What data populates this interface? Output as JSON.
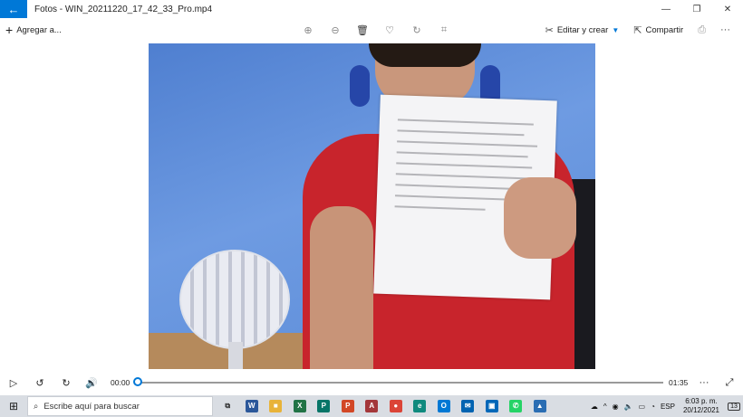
{
  "window": {
    "back_icon": "back-arrow-icon",
    "title": "Fotos - WIN_20211220_17_42_33_Pro.mp4",
    "controls": [
      "minimize-icon",
      "maximize-icon",
      "close-icon"
    ]
  },
  "toolbar": {
    "add_label": "Agregar a...",
    "center_icons": [
      "zoom-in-icon",
      "zoom-out-icon",
      "delete-icon",
      "heart-icon",
      "rotate-icon",
      "crop-icon"
    ],
    "edit_label": "Editar y crear",
    "share_label": "Compartir",
    "more_icon": "more-icon"
  },
  "player": {
    "current_time": "00:00",
    "duration": "01:35",
    "progress": 0,
    "icons": [
      "play-icon",
      "rewind-10-icon",
      "forward-30-icon",
      "volume-icon",
      "more-icon",
      "fullscreen-icon"
    ]
  },
  "taskbar": {
    "search_placeholder": "Escribe aquí para buscar",
    "apps": [
      {
        "name": "task-view-icon",
        "glyph": "⧉",
        "color": "#2b2b2b"
      },
      {
        "name": "word-icon",
        "glyph": "W",
        "color": "#2b579a"
      },
      {
        "name": "file-explorer-icon",
        "glyph": "■",
        "color": "#e8b339"
      },
      {
        "name": "excel-icon",
        "glyph": "X",
        "color": "#217346"
      },
      {
        "name": "publisher-icon",
        "glyph": "P",
        "color": "#077568"
      },
      {
        "name": "powerpoint-icon",
        "glyph": "P",
        "color": "#d24726"
      },
      {
        "name": "access-icon",
        "glyph": "A",
        "color": "#a4373a"
      },
      {
        "name": "chrome-icon",
        "glyph": "●",
        "color": "#db4437"
      },
      {
        "name": "edge-icon",
        "glyph": "e",
        "color": "#0f8a7e"
      },
      {
        "name": "outlook-icon",
        "glyph": "O",
        "color": "#0078d4"
      },
      {
        "name": "mail-icon",
        "glyph": "✉",
        "color": "#0063b1"
      },
      {
        "name": "store-icon",
        "glyph": "▣",
        "color": "#0067b8"
      },
      {
        "name": "whatsapp-icon",
        "glyph": "✆",
        "color": "#25d366"
      },
      {
        "name": "photos-icon",
        "glyph": "▲",
        "color": "#2a6db3"
      }
    ],
    "tray": {
      "language": "ESP",
      "time": "6:03 p. m.",
      "date": "20/12/2021",
      "notification_count": "13"
    }
  }
}
